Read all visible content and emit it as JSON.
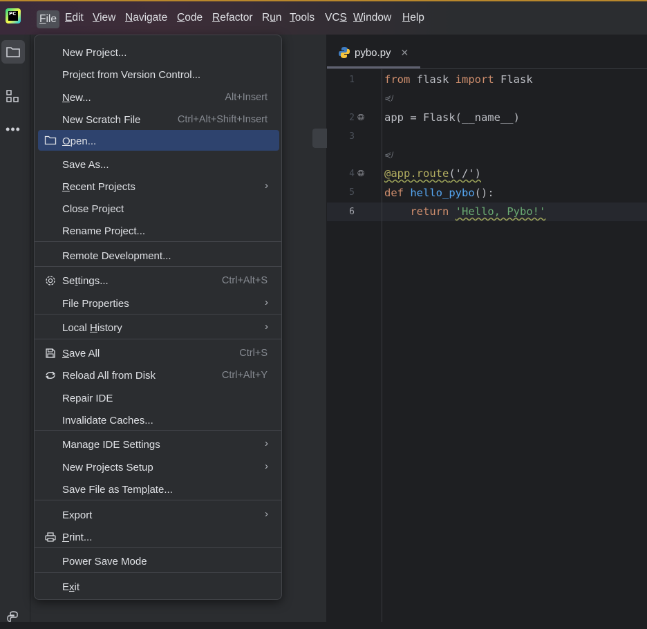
{
  "menubar": {
    "logo_text": "PC",
    "items": [
      {
        "label": "File",
        "u": "F",
        "rest": "ile"
      },
      {
        "label": "Edit",
        "u": "E",
        "rest": "dit"
      },
      {
        "label": "View",
        "u": "V",
        "rest": "iew"
      },
      {
        "label": "Navigate",
        "u": "N",
        "rest": "avigate"
      },
      {
        "label": "Code",
        "u": "C",
        "rest": "ode"
      },
      {
        "label": "Refactor",
        "u": "R",
        "rest": "efactor"
      },
      {
        "label": "Run",
        "pre": "R",
        "u": "u",
        "rest": "n"
      },
      {
        "label": "Tools",
        "u": "T",
        "rest": "ools"
      },
      {
        "label": "VCS",
        "pre": "VC",
        "u": "S",
        "rest": ""
      },
      {
        "label": "Window",
        "u": "W",
        "rest": "indow"
      },
      {
        "label": "Help",
        "u": "H",
        "rest": "elp"
      }
    ]
  },
  "file_menu": {
    "new_project": "New Project...",
    "project_from_vcs": "Project from Version Control...",
    "new": {
      "u": "N",
      "rest": "ew...",
      "shortcut": "Alt+Insert"
    },
    "new_scratch": {
      "label": "New Scratch File",
      "shortcut": "Ctrl+Alt+Shift+Insert"
    },
    "open": {
      "u": "O",
      "rest": "pen..."
    },
    "save_as": "Save As...",
    "recent_projects": {
      "u": "R",
      "rest": "ecent Projects"
    },
    "close_project": "Close Project",
    "rename_project": "Rename Project...",
    "remote_dev": "Remote Development...",
    "settings": {
      "pre": "Se",
      "u": "t",
      "rest": "tings...",
      "shortcut": "Ctrl+Alt+S"
    },
    "file_properties": "File Properties",
    "local_history": {
      "pre": "Local ",
      "u": "H",
      "rest": "istory"
    },
    "save_all": {
      "u": "S",
      "rest": "ave All",
      "shortcut": "Ctrl+S"
    },
    "reload": {
      "label": "Reload All from Disk",
      "shortcut": "Ctrl+Alt+Y"
    },
    "repair_ide": "Repair IDE",
    "invalidate_caches": "Invalidate Caches...",
    "manage_ide_settings": "Manage IDE Settings",
    "new_projects_setup": "New Projects Setup",
    "save_as_template": {
      "pre": "Save File as Temp",
      "u": "l",
      "rest": "ate..."
    },
    "export": "Export",
    "print": {
      "u": "P",
      "rest": "rint..."
    },
    "power_save": "Power Save Mode",
    "exit": {
      "pre": "E",
      "u": "x",
      "rest": "it"
    }
  },
  "editor": {
    "tab_name": "pybo.py",
    "line_numbers": [
      "1",
      "2",
      "3",
      "4",
      "5",
      "6"
    ],
    "hint": "⋞/",
    "code": {
      "l1_from": "from",
      "l1_mod": " flask ",
      "l1_import": "import",
      "l1_cls": " Flask",
      "l2": "app = Flask(__name__)",
      "l4_deco": "@app.route",
      "l4_args": "('/')",
      "l5_def": "def",
      "l5_fn": "hello_pybo",
      "l5_rest": "():",
      "l6_ret": "return",
      "l6_str": "'Hello, Pybo!'"
    }
  },
  "colors": {
    "accent": "#2e436e",
    "keyword": "#cf8e6d",
    "function": "#56a8f5",
    "string": "#6aab73"
  }
}
